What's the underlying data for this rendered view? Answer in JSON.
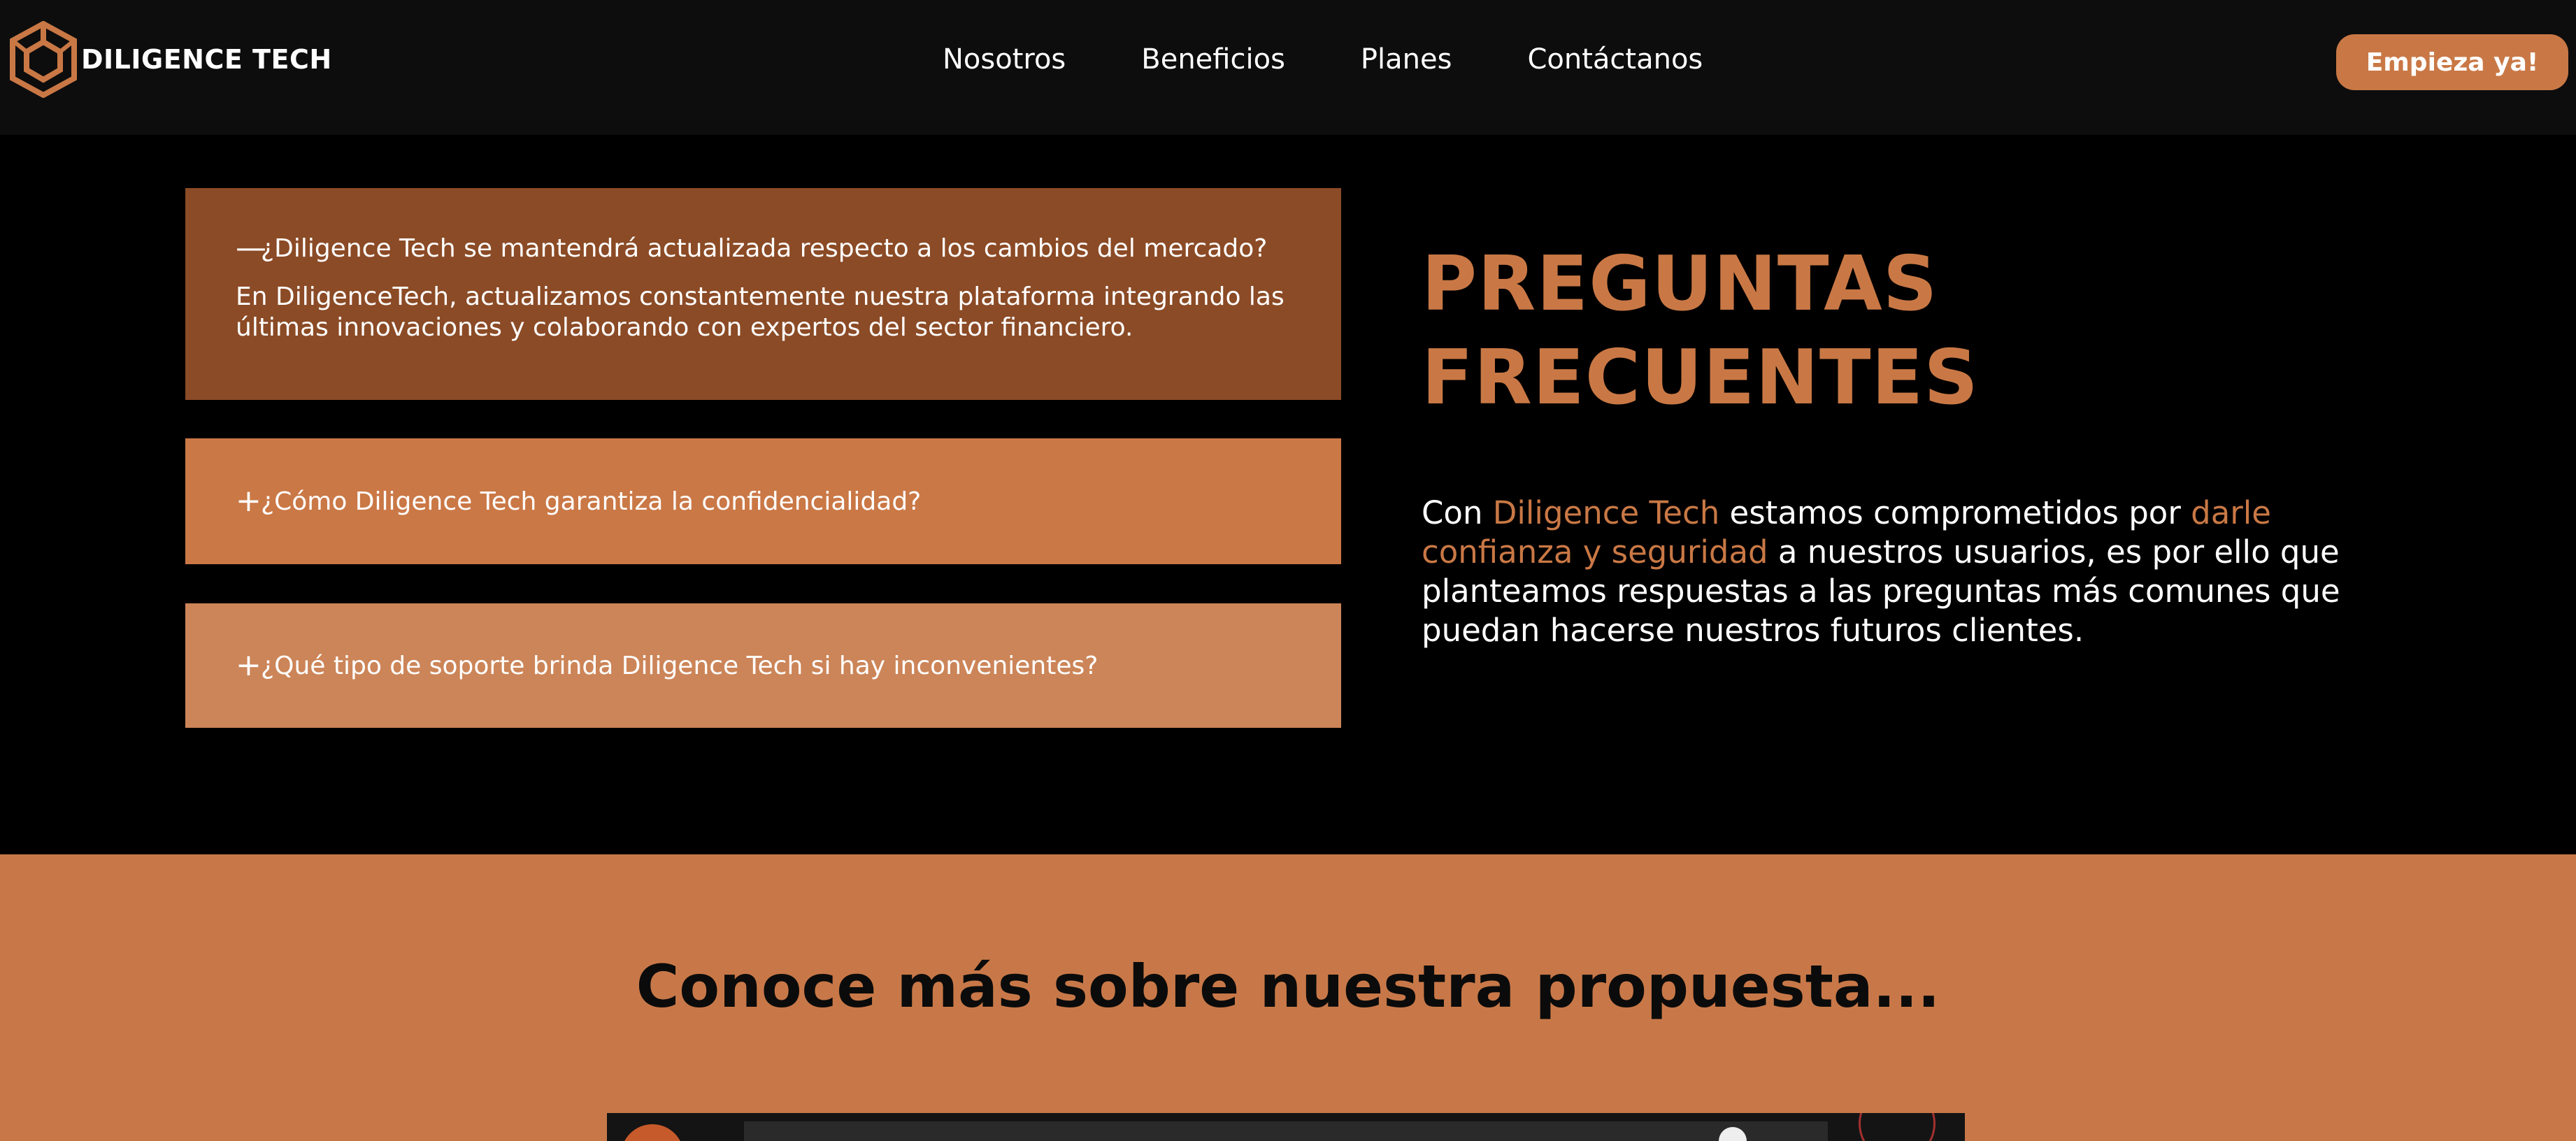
{
  "header": {
    "brand": "DILIGENCE TECH",
    "nav": [
      "Nosotros",
      "Beneficios",
      "Planes",
      "Contáctanos"
    ],
    "cta": "Empieza ya!"
  },
  "faq": {
    "items": [
      {
        "sign": "—",
        "question": "¿Diligence Tech se mantendrá actualizada respecto a los cambios del mercado?",
        "answer": "En DiligenceTech, actualizamos constantemente nuestra plataforma integrando las últimas innovaciones y colaborando con expertos del sector financiero.",
        "expanded": true,
        "color": "#8b4b26"
      },
      {
        "sign": "+",
        "question": "¿Cómo Diligence Tech garantiza la confidencialidad?",
        "expanded": false,
        "color": "#ca7846"
      },
      {
        "sign": "+",
        "question": "¿Qué tipo de soporte brinda Diligence Tech si hay inconvenientes?",
        "expanded": false,
        "color": "#cc8558"
      }
    ],
    "title_line1": "PREGUNTAS",
    "title_line2": "FRECUENTES",
    "desc_parts": [
      "Con ",
      "Diligence Tech",
      " estamos comprometidos por ",
      "darle confianza y seguridad",
      " a nuestros usuarios, es por ello que planteamos respuestas a las preguntas más comunes que puedan hacerse nuestros futuros clientes."
    ]
  },
  "section": {
    "title": "Conoce más sobre nuestra propuesta..."
  },
  "colors": {
    "accent": "#c97845",
    "header_bg": "#0d0d0d",
    "page_bg": "#000000",
    "section_bg": "#c87848"
  },
  "icons": [
    "diligence-logo-icon",
    "minus-icon",
    "plus-icon",
    "video-player"
  ]
}
